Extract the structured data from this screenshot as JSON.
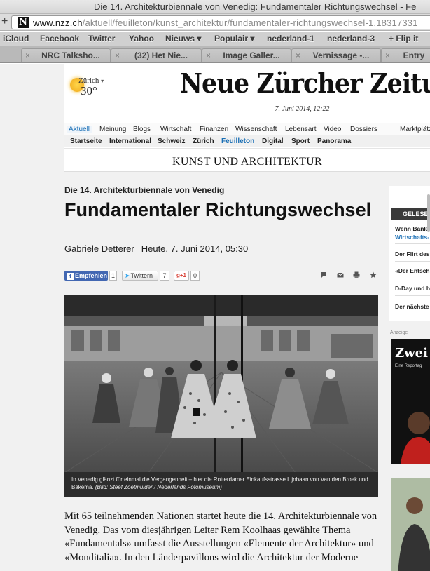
{
  "window": {
    "title": "Die 14. Architekturbiennale von Venedig: Fundamentaler Richtungswechsel - Fe"
  },
  "address_bar": {
    "host": "www.nzz.ch",
    "path": "/aktuell/feuilleton/kunst_architektur/fundamentaler-richtungswechsel-1.18317331",
    "favicon_letter": "N"
  },
  "bookmarks": [
    "iCloud",
    "Facebook",
    "Twitter",
    "Yahoo",
    "Nieuws ▾",
    "Populair ▾",
    "nederland-1",
    "nederland-3",
    "+ Flip it"
  ],
  "tabs": [
    "NRC Talksho...",
    "(32) Het Nie...",
    "Image Galler...",
    "Vernissage -...",
    "Entry"
  ],
  "masthead": {
    "weather_city": "Zürich",
    "weather_caret": "▾",
    "weather_temp": "30°",
    "logo": "Neue Zürcher Zeitung",
    "dateline": "– 7. Juni 2014, 12:22 –"
  },
  "nav_primary": [
    "Aktuell",
    "Meinung",
    "Blogs",
    "Wirtschaft",
    "Finanzen",
    "Wissenschaft",
    "Lebensart",
    "Video",
    "Dossiers",
    "Marktplätze"
  ],
  "nav_secondary": [
    "Startseite",
    "International",
    "Schweiz",
    "Zürich",
    "Feuilleton",
    "Digital",
    "Sport",
    "Panorama"
  ],
  "section_title": "KUNST UND ARCHITEKTUR",
  "article": {
    "kicker": "Die 14. Architekturbiennale von Venedig",
    "headline": "Fundamentaler Richtungswechsel",
    "author": "Gabriele Detterer",
    "date": "Heute, 7. Juni 2014, 05:30",
    "caption": "In Venedig glänzt für einmal die Vergangenheit – hier die Rotterdamer Einkaufsstrasse Lijnbaan von Van den Broek und Bakema.",
    "credit": "(Bild: Steef Zoetmulder / Nederlands Fotomuseum)",
    "body": "Mit 65 teilnehmenden Nationen startet heute die 14. Architekturbiennale von Venedig. Das vom diesjährigen Leiter Rem Koolhaas gewählte Thema «Fundamentals» umfasst die Ausstellungen «Elemente der Architektur» und «Monditalia». In den Länderpavillons wird die Architektur der Moderne"
  },
  "social": {
    "facebook_label": "Empfehlen",
    "facebook_count": "1",
    "twitter_label": "Twittern",
    "twitter_count": "7",
    "gplus_label": "g+1",
    "gplus_count": "0"
  },
  "sidebar": {
    "header": "GELESEN",
    "items": [
      "Wenn Banke",
      "Wirtschafts-",
      "Der Flirt des",
      "«Der Entsch",
      "D-Day und h",
      "Der nächste"
    ],
    "ad_label": "Anzeige",
    "ad_title": "Zwei",
    "ad_sub": "Eine Reportag"
  },
  "colors": {
    "nzz_blue": "#1a6fb5",
    "facebook": "#4267b2",
    "caption_bg": "#2c2c2c"
  }
}
